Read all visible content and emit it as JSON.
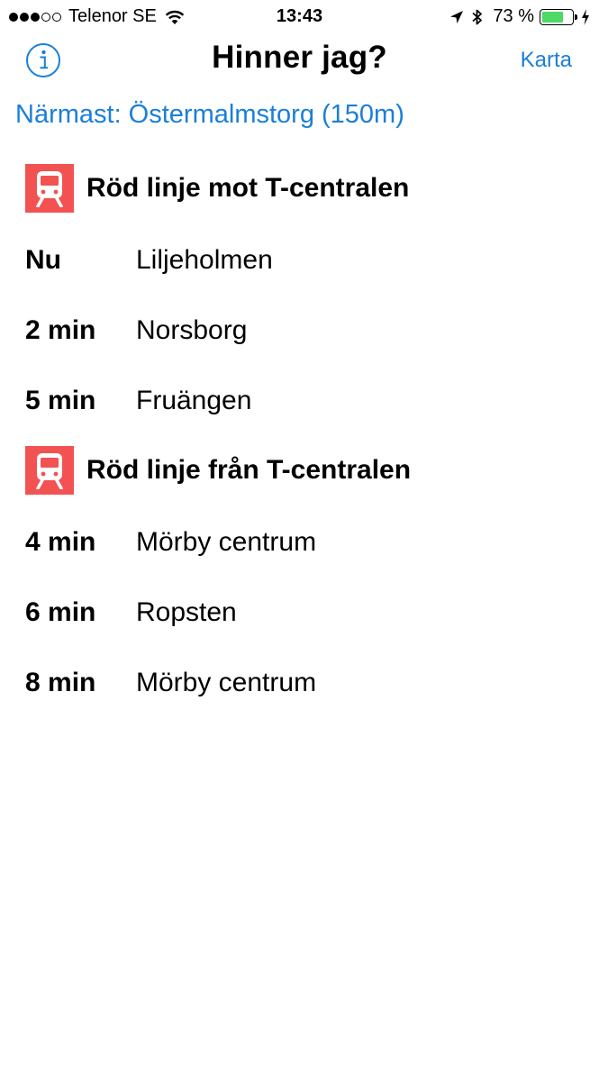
{
  "status_bar": {
    "carrier": "Telenor SE",
    "signal_bars_filled": 3,
    "signal_bars_total": 5,
    "time": "13:43",
    "battery_percent": "73 %",
    "battery_level": 0.73,
    "battery_color": "#4cd964",
    "icons": [
      "wifi-icon",
      "location-arrow-icon",
      "bluetooth-icon",
      "battery-icon",
      "charging-bolt-icon"
    ]
  },
  "nav": {
    "title": "Hinner jag?",
    "right_button": "Karta",
    "left_icon": "info-icon"
  },
  "nearest": "Närmast: Östermalmstorg (150m)",
  "accent_color": "#1a7fd9",
  "line_color": "#f25252",
  "sections": [
    {
      "icon": "train-icon",
      "title": "Röd linje mot T-centralen",
      "departures": [
        {
          "time": "Nu",
          "destination": "Liljeholmen"
        },
        {
          "time": "2 min",
          "destination": "Norsborg"
        },
        {
          "time": "5 min",
          "destination": "Fruängen"
        }
      ]
    },
    {
      "icon": "train-icon",
      "title": "Röd linje från T-centralen",
      "departures": [
        {
          "time": "4 min",
          "destination": "Mörby centrum"
        },
        {
          "time": "6 min",
          "destination": "Ropsten"
        },
        {
          "time": "8 min",
          "destination": "Mörby centrum"
        }
      ]
    }
  ]
}
